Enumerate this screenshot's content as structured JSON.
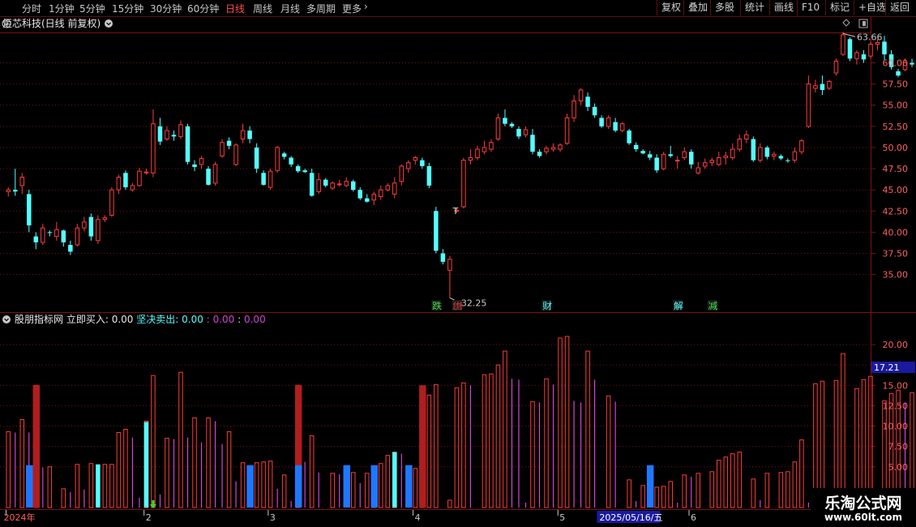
{
  "toolbar": {
    "periods": [
      {
        "label": "分时",
        "active": false
      },
      {
        "label": "1分钟",
        "active": false
      },
      {
        "label": "5分钟",
        "active": false
      },
      {
        "label": "15分钟",
        "active": false
      },
      {
        "label": "30分钟",
        "active": false
      },
      {
        "label": "60分钟",
        "active": false
      },
      {
        "label": "日线",
        "active": true
      },
      {
        "label": "周线",
        "active": false
      },
      {
        "label": "月线",
        "active": false
      },
      {
        "label": "多周期",
        "active": false
      },
      {
        "label": "更多",
        "active": false
      }
    ],
    "actions": [
      "复权",
      "叠加",
      "多股",
      "统计",
      "画线",
      "F10",
      "标记",
      "+自选",
      "返回"
    ]
  },
  "colors": {
    "up": "#ff3c3c",
    "down": "#54ffff",
    "grid": "#7a1212",
    "axis": "#c8c8c8",
    "buy_bar": "#b01e1e",
    "sell_bar": "#1e78ff",
    "cyan_bar": "#54ffff",
    "magenta": "#d046d0",
    "highlight": "#ff3c3c",
    "date_badge_bg": "#1a1aa0"
  },
  "price_panel": {
    "title": "炬芯科技(日线 前复权)",
    "y_ticks": [
      "60.00",
      "57.50",
      "55.00",
      "52.50",
      "50.00",
      "47.50",
      "45.00",
      "42.50",
      "40.00",
      "37.50",
      "35.00"
    ],
    "high_label": "63.66",
    "low_label": "32.25",
    "t_marker": "T",
    "event_tags": [
      {
        "text": "跌",
        "bar": 62,
        "color": "#40e040"
      },
      {
        "text": "龙虎榜",
        "bar": 65,
        "color": "#ff4040"
      },
      {
        "text": "财",
        "bar": 78,
        "color": "#54ffff"
      },
      {
        "text": "解",
        "bar": 97,
        "color": "#54ffff"
      },
      {
        "text": "减",
        "bar": 102,
        "color": "#40e040"
      }
    ]
  },
  "indicator_panel": {
    "title": "股朋指标网",
    "buy_label": "立即买入:",
    "buy_value": "0.00",
    "sell_label": "坚决卖出:",
    "sell_value": "0.00",
    "sep": ":",
    "value3": "0.00",
    "value4": "0.00",
    "y_ticks": [
      "20.00",
      "17.50",
      "15.00",
      "12.50",
      "10.00",
      "7.50",
      "5.00"
    ],
    "current_value": "17.21"
  },
  "x_axis": {
    "labels": [
      {
        "text": "2024年",
        "bar": 0
      },
      {
        "text": "2",
        "bar": 20
      },
      {
        "text": "3",
        "bar": 38
      },
      {
        "text": "4",
        "bar": 59
      },
      {
        "text": "5",
        "bar": 80
      },
      {
        "text": "6",
        "bar": 99
      }
    ],
    "cursor_date": "2025/05/16/五",
    "cursor_bar": 88
  },
  "watermark": {
    "title": "乐淘公式网",
    "url": "www.60lt.com"
  },
  "chart_data": {
    "type": "candlestick",
    "price": {
      "ylim": [
        33,
        64
      ],
      "bars": [
        [
          44.8,
          45.3,
          44.2,
          45.0
        ],
        [
          45.0,
          47.5,
          44.3,
          44.8
        ],
        [
          45.5,
          47.0,
          44.5,
          46.5
        ],
        [
          44.5,
          45.0,
          40.0,
          40.8
        ],
        [
          39.5,
          40.0,
          38.0,
          38.8
        ],
        [
          38.8,
          41.0,
          38.5,
          40.5
        ],
        [
          40.0,
          40.2,
          39.5,
          39.9
        ],
        [
          39.5,
          41.2,
          39.0,
          40.3
        ],
        [
          40.2,
          40.3,
          38.3,
          38.8
        ],
        [
          38.5,
          39.0,
          37.3,
          37.7
        ],
        [
          38.5,
          41.0,
          38.3,
          40.5
        ],
        [
          40.5,
          41.8,
          40.1,
          41.2
        ],
        [
          41.8,
          42.2,
          39.0,
          39.5
        ],
        [
          39.0,
          42.0,
          38.6,
          41.5
        ],
        [
          41.5,
          42.0,
          41.2,
          41.7
        ],
        [
          42.0,
          45.3,
          41.8,
          45.0
        ],
        [
          45.0,
          46.8,
          44.5,
          46.5
        ],
        [
          47.0,
          47.3,
          45.0,
          45.3
        ],
        [
          45.0,
          45.8,
          44.8,
          45.5
        ],
        [
          45.5,
          47.6,
          45.4,
          47.2
        ],
        [
          47.0,
          47.5,
          46.8,
          47.1
        ],
        [
          47.0,
          54.5,
          46.5,
          52.8
        ],
        [
          52.5,
          53.5,
          50.3,
          50.7
        ],
        [
          51.0,
          52.5,
          50.8,
          52.0
        ],
        [
          51.5,
          52.0,
          50.8,
          51.3
        ],
        [
          51.3,
          53.2,
          51.0,
          52.7
        ],
        [
          52.5,
          52.8,
          48.0,
          48.3
        ],
        [
          48.0,
          48.5,
          47.2,
          47.7
        ],
        [
          48.0,
          49.0,
          47.5,
          48.7
        ],
        [
          47.5,
          47.8,
          45.5,
          45.6
        ],
        [
          45.8,
          48.3,
          45.5,
          48.0
        ],
        [
          49.0,
          51.0,
          48.8,
          50.6
        ],
        [
          50.8,
          51.2,
          49.8,
          50.2
        ],
        [
          48.0,
          50.5,
          47.8,
          50.3
        ],
        [
          51.0,
          52.8,
          50.5,
          52.0
        ],
        [
          52.0,
          52.5,
          50.5,
          51.0
        ],
        [
          50.0,
          50.5,
          47.0,
          47.5
        ],
        [
          47.0,
          47.3,
          45.5,
          45.6
        ],
        [
          45.3,
          47.5,
          45.0,
          47.2
        ],
        [
          47.3,
          50.2,
          47.0,
          50.0
        ],
        [
          49.3,
          49.5,
          48.6,
          48.9
        ],
        [
          48.8,
          49.0,
          47.7,
          48.0
        ],
        [
          47.8,
          48.0,
          47.0,
          47.2
        ],
        [
          47.3,
          47.5,
          47.0,
          47.1
        ],
        [
          47.0,
          47.5,
          44.2,
          44.3
        ],
        [
          44.8,
          47.0,
          44.5,
          46.2
        ],
        [
          46.2,
          46.4,
          45.3,
          45.5
        ],
        [
          45.2,
          46.0,
          45.0,
          45.8
        ],
        [
          45.6,
          46.2,
          45.4,
          45.7
        ],
        [
          45.5,
          46.5,
          45.3,
          46.0
        ],
        [
          46.0,
          46.2,
          44.8,
          45.0
        ],
        [
          45.0,
          45.3,
          43.8,
          44.0
        ],
        [
          44.0,
          44.5,
          43.5,
          43.6
        ],
        [
          43.8,
          44.8,
          43.2,
          44.5
        ],
        [
          44.2,
          45.5,
          43.8,
          45.0
        ],
        [
          45.0,
          45.8,
          44.8,
          45.5
        ],
        [
          44.5,
          46.5,
          44.0,
          45.8
        ],
        [
          46.0,
          48.0,
          45.5,
          47.8
        ],
        [
          47.5,
          48.5,
          47.0,
          48.2
        ],
        [
          48.5,
          49.0,
          48.0,
          48.8
        ],
        [
          48.5,
          48.8,
          47.5,
          47.8
        ],
        [
          47.8,
          48.2,
          45.2,
          45.5
        ],
        [
          42.5,
          43.0,
          37.5,
          37.8
        ],
        [
          37.5,
          38.0,
          36.2,
          36.5
        ],
        [
          35.5,
          37.2,
          32.25,
          36.8
        ],
        [
          42.5,
          42.8,
          42.3,
          42.6
        ],
        [
          43.0,
          48.8,
          42.8,
          48.5
        ],
        [
          48.5,
          49.8,
          48.0,
          48.8
        ],
        [
          48.8,
          50.2,
          48.5,
          49.8
        ],
        [
          49.5,
          50.8,
          49.2,
          50.0
        ],
        [
          49.8,
          51.0,
          49.5,
          50.6
        ],
        [
          51.0,
          54.0,
          50.8,
          53.5
        ],
        [
          53.5,
          54.5,
          52.5,
          52.8
        ],
        [
          52.8,
          53.0,
          52.3,
          52.5
        ],
        [
          52.2,
          52.5,
          51.0,
          51.3
        ],
        [
          51.5,
          52.5,
          51.2,
          52.1
        ],
        [
          51.5,
          52.2,
          49.2,
          49.5
        ],
        [
          49.5,
          49.8,
          48.8,
          49.0
        ],
        [
          49.5,
          50.2,
          49.2,
          49.9
        ],
        [
          49.8,
          50.5,
          49.5,
          50.0
        ],
        [
          49.8,
          50.5,
          49.5,
          50.3
        ],
        [
          50.5,
          54.0,
          50.3,
          53.5
        ],
        [
          53.5,
          56.2,
          53.0,
          55.5
        ],
        [
          55.5,
          57.0,
          55.0,
          56.8
        ],
        [
          56.0,
          56.5,
          54.3,
          54.8
        ],
        [
          54.8,
          55.2,
          53.5,
          53.8
        ],
        [
          53.5,
          53.8,
          52.3,
          52.5
        ],
        [
          52.5,
          53.8,
          52.2,
          53.5
        ],
        [
          53.0,
          53.5,
          51.8,
          52.0
        ],
        [
          52.0,
          53.0,
          51.8,
          52.8
        ],
        [
          52.0,
          52.2,
          50.3,
          50.5
        ],
        [
          50.3,
          50.6,
          49.5,
          49.8
        ],
        [
          49.6,
          49.8,
          49.2,
          49.3
        ],
        [
          49.2,
          49.6,
          48.5,
          48.8
        ],
        [
          48.8,
          49.2,
          47.0,
          47.3
        ],
        [
          47.5,
          49.5,
          47.3,
          49.2
        ],
        [
          49.2,
          50.2,
          48.8,
          49.0
        ],
        [
          48.5,
          49.0,
          47.5,
          48.5
        ],
        [
          48.8,
          50.0,
          48.5,
          49.5
        ],
        [
          49.5,
          49.8,
          47.5,
          48.0
        ],
        [
          47.0,
          48.3,
          46.8,
          47.6
        ],
        [
          47.8,
          48.7,
          47.5,
          48.2
        ],
        [
          48.2,
          48.8,
          47.8,
          48.5
        ],
        [
          48.0,
          49.5,
          47.8,
          48.8
        ],
        [
          48.8,
          49.5,
          48.0,
          49.0
        ],
        [
          48.8,
          50.5,
          48.5,
          49.8
        ],
        [
          49.8,
          51.5,
          49.5,
          51.0
        ],
        [
          51.0,
          52.0,
          50.5,
          51.5
        ],
        [
          51.0,
          51.3,
          48.3,
          48.5
        ],
        [
          48.5,
          50.5,
          48.2,
          50.0
        ],
        [
          50.0,
          50.2,
          48.6,
          48.9
        ],
        [
          49.0,
          49.5,
          48.5,
          49.2
        ],
        [
          49.0,
          49.2,
          48.5,
          48.7
        ],
        [
          48.5,
          48.7,
          48.2,
          48.4
        ],
        [
          48.5,
          50.0,
          48.2,
          49.5
        ],
        [
          49.5,
          51.0,
          49.2,
          50.8
        ],
        [
          52.5,
          58.5,
          52.3,
          57.5
        ],
        [
          57.0,
          58.0,
          56.5,
          57.3
        ],
        [
          57.5,
          58.5,
          56.2,
          56.8
        ],
        [
          57.0,
          58.0,
          56.8,
          57.8
        ],
        [
          58.8,
          60.5,
          58.5,
          60.2
        ],
        [
          61.0,
          63.66,
          60.8,
          63.3
        ],
        [
          62.8,
          63.0,
          60.2,
          60.5
        ],
        [
          60.5,
          61.5,
          59.8,
          61.2
        ],
        [
          61.0,
          61.5,
          60.0,
          60.4
        ],
        [
          60.8,
          62.5,
          60.5,
          62.2
        ],
        [
          62.2,
          62.8,
          61.5,
          62.4
        ],
        [
          62.5,
          63.2,
          60.3,
          61.0
        ],
        [
          61.0,
          61.5,
          59.2,
          59.5
        ],
        [
          59.0,
          59.3,
          58.3,
          58.5
        ],
        [
          59.2,
          60.5,
          59.0,
          60.0
        ],
        [
          60.0,
          60.5,
          59.5,
          59.8
        ],
        [
          60.0,
          60.3,
          58.9,
          59.3
        ],
        [
          58.6,
          59.3,
          58.3,
          59.0
        ]
      ]
    },
    "indicator": {
      "ylim": [
        0,
        22
      ],
      "values": [
        9.3,
        9.2,
        10.8,
        9.2,
        15.0,
        4.9,
        5.0,
        0.3,
        2.3,
        1.9,
        5.3,
        2.2,
        5.4,
        5.1,
        5.3,
        5.3,
        9.2,
        9.6,
        8.6,
        1.2,
        10.6,
        16.2,
        1.6,
        8.5,
        8.4,
        16.6,
        8.6,
        11.0,
        8.0,
        11.0,
        10.6,
        7.8,
        9.3,
        3.2,
        5.5,
        1.7,
        5.5,
        5.6,
        5.7,
        2.3,
        4.0,
        0.8,
        15.0,
        5.6,
        8.8,
        4.3,
        0.5,
        4.2,
        4.1,
        1.0,
        4.3,
        3.0,
        4.2,
        4.8,
        5.4,
        6.4,
        6.8,
        6.6,
        0.5,
        4.8,
        4.8,
        13.8,
        15.1,
        0.4,
        0.9,
        14.7,
        15.3,
        15.0,
        0.4,
        16.3,
        16.4,
        17.5,
        19.2,
        15.8,
        15.7,
        0.6,
        13.0,
        12.9,
        15.8,
        15.1,
        20.8,
        21.0,
        13.1,
        12.9,
        19.2,
        15.7,
        0.3,
        13.7,
        13.0,
        0.3,
        3.4,
        0.8,
        2.7,
        2.5,
        2.5,
        2.6,
        3.2,
        0.6,
        4.0,
        3.8,
        4.2,
        0.3,
        4.4,
        5.8,
        6.2,
        6.6,
        6.8,
        0.5,
        3.5,
        0.9,
        4.2,
        0.2,
        4.3,
        4.4,
        5.6,
        8.3,
        0.6,
        15.2,
        15.5,
        0.5,
        15.6,
        18.9,
        0.5,
        14.6,
        15.7,
        16.1,
        0.6,
        13.1,
        14.0,
        14.4,
        12.8,
        14.1,
        12.8
      ],
      "buy_bars": [
        4,
        42,
        60
      ],
      "sell_bars": [
        3,
        35,
        42,
        49,
        53,
        58,
        93
      ],
      "cyan_bars": [
        13,
        20,
        56
      ],
      "arrows": [
        21,
        118
      ]
    }
  }
}
